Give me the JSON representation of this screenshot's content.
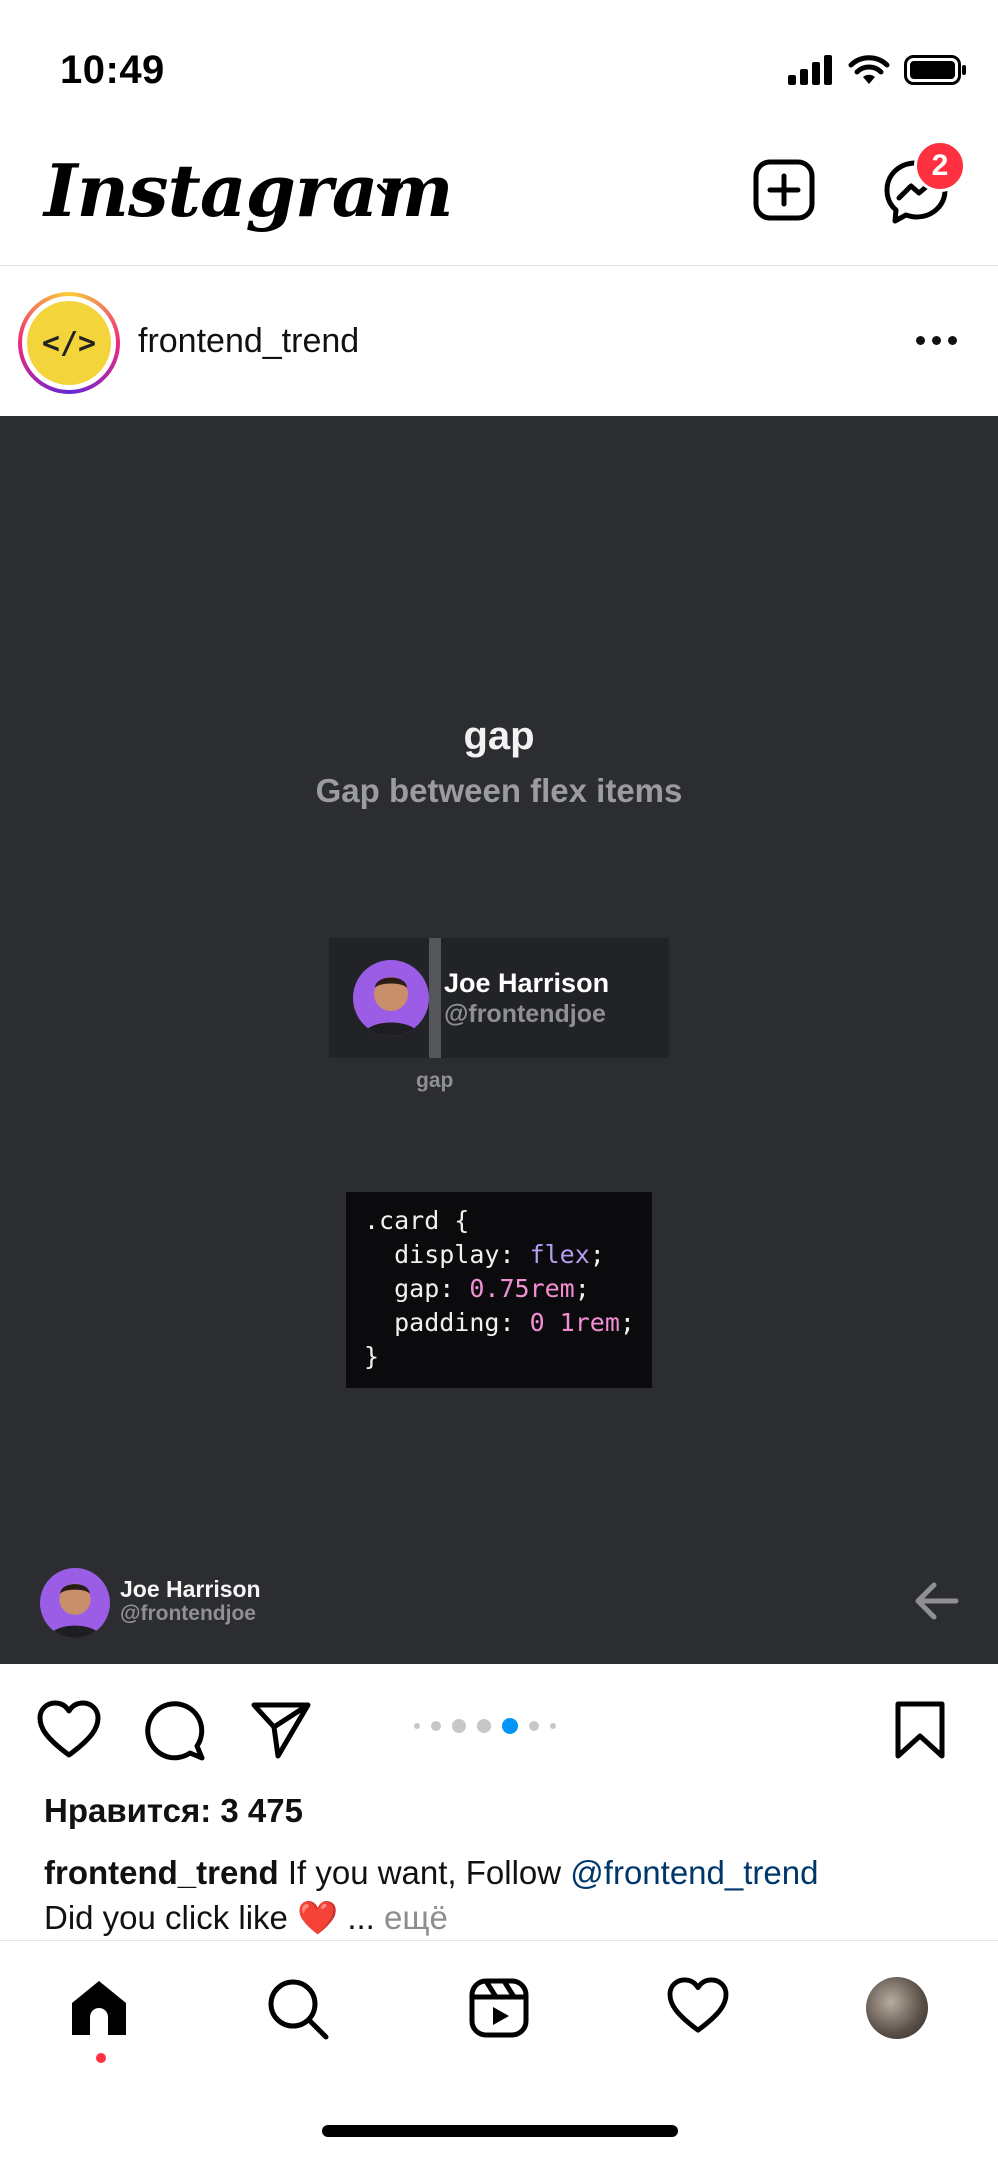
{
  "status_bar": {
    "time": "10:49"
  },
  "header": {
    "logo": "Instagram",
    "messenger_badge": "2"
  },
  "post": {
    "avatar_text": "</>",
    "username": "frontend_trend",
    "slide": {
      "title": "gap",
      "subtitle": "Gap between flex items",
      "card_name": "Joe Harrison",
      "card_handle": "@frontendjoe",
      "gap_label": "gap",
      "code": {
        "line1": ".card {",
        "display_prop": "  display: ",
        "display_val": "flex",
        "gap_prop": "  gap: ",
        "gap_val": "0.75rem",
        "padding_prop": "  padding: ",
        "padding_val": "0 1rem",
        "semicolon": ";",
        "close": "}"
      },
      "author_name": "Joe Harrison",
      "author_handle": "@frontendjoe"
    },
    "carousel": {
      "total": 7,
      "active_index": 4
    },
    "likes": "Нравится: 3 475",
    "caption": {
      "username": "frontend_trend",
      "text": " If you want, Follow ",
      "mention": "@frontend_trend",
      "line2": "Did you click like ",
      "emoji": "❤️",
      "ellipsis": " ... ",
      "more": "ещё"
    }
  },
  "colors": {
    "media_bg": "#2c2d31",
    "accent_blue": "#0095f6",
    "badge_red": "#ff3040",
    "mention": "#00376b"
  },
  "icons": {
    "header": [
      "chevron-down-icon",
      "add-post-icon",
      "messenger-icon"
    ],
    "actions": [
      "heart-icon",
      "comment-icon",
      "share-icon",
      "bookmark-icon"
    ],
    "nav": [
      "home-icon",
      "search-icon",
      "reels-icon",
      "activity-heart-icon",
      "profile-avatar"
    ]
  }
}
